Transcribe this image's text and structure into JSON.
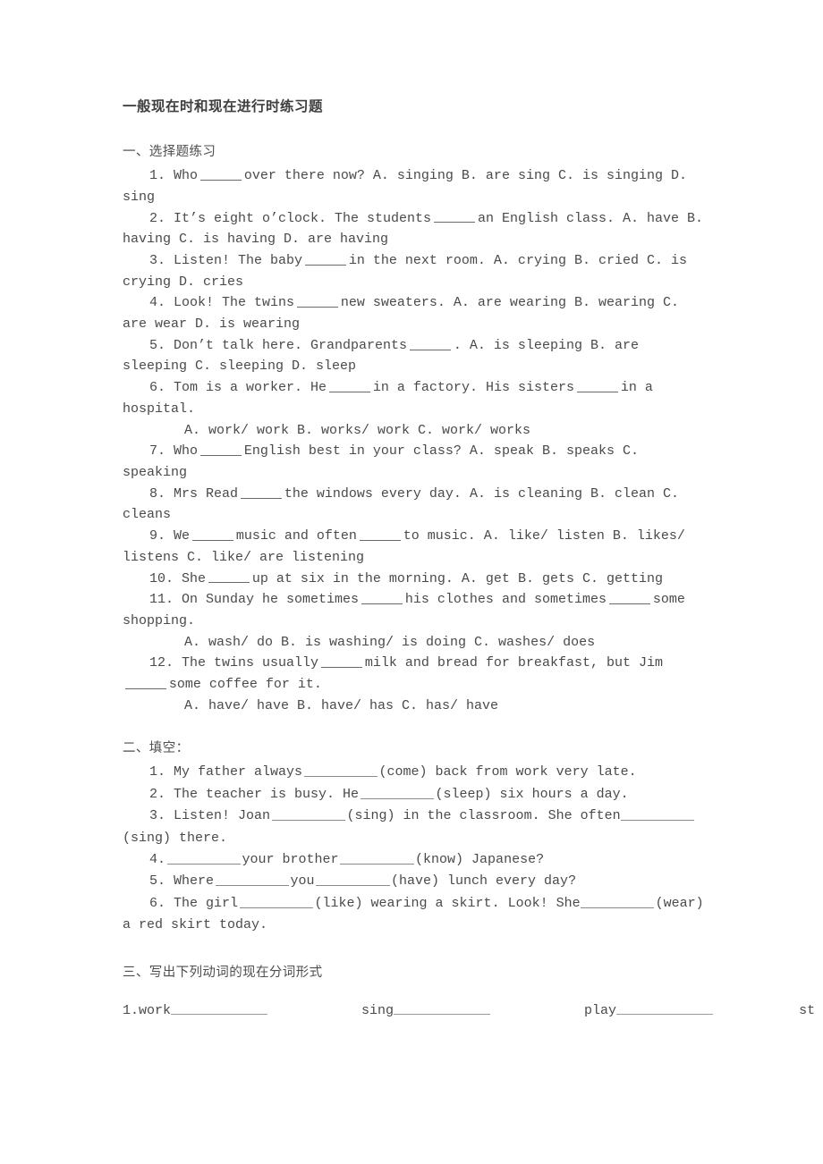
{
  "document": {
    "title": "一般现在时和现在进行时练习题"
  },
  "section_one": {
    "heading": "一、选择题练习",
    "questions": [
      {
        "parts": [
          "1. Who ",
          " over there now?    A. singing     B. are sing     C. is singing     D. sing"
        ],
        "blanks": 1,
        "text_before": "1. Who",
        "text_after": "over there now?    A. singing     B. are sing     C. is singing     D. sing"
      },
      {
        "text_before": "2. It’s eight o’clock. The students",
        "text_after": "an English class.     A. have    B. having    C. is having D. are having"
      },
      {
        "text_before": "3. Listen! The baby",
        "text_after": "in the next room.    A. crying    B. cried    C. is crying     D. cries"
      },
      {
        "text_before": "4. Look! The twins",
        "text_after": "new sweaters.    A. are wearing    B. wearing    C. are wear    D. is wearing"
      },
      {
        "text_before": "5. Don’t talk here. Grandparents",
        "text_after": ". A. is sleeping    B. are sleeping    C. sleeping    D. sleep"
      },
      {
        "text_before": "6. Tom is a worker. He",
        "text_middle": "in a factory. His sisters",
        "text_after": "in a hospital."
      },
      {
        "options_line": "A. work/ work    B. works/ work    C. work/ works"
      },
      {
        "text_before": "7. Who",
        "text_after": "English best in your class?    A. speak    B. speaks    C. speaking"
      },
      {
        "text_before": "8. Mrs Read",
        "text_after": "the windows every day.    A. is cleaning    B. clean    C. cleans"
      },
      {
        "text_before": "9. We",
        "text_middle": "music and often",
        "text_after": "to music.    A. like/ listen    B. likes/ listens    C. like/ are listening"
      },
      {
        "text_before": "10. She",
        "text_after": "up at six in the morning.    A. get    B. gets    C. getting"
      },
      {
        "text_before": "11. On Sunday he sometimes",
        "text_middle": "his clothes and sometimes",
        "text_after": "some shopping."
      },
      {
        "options_line": "A. wash/ do    B. is washing/ is doing    C. washes/ does"
      },
      {
        "text_before": "12. The twins usually",
        "text_middle": "milk and bread for breakfast, but Jim",
        "text_after": "some coffee for it."
      },
      {
        "options_line": "A. have/ have    B. have/ has    C. has/ have"
      }
    ],
    "q1_before": "1. Who",
    "q1_after": "over there now?    A. singing     B. are sing     C. is singing     D. sing",
    "q2_before": "2. It’s eight o’clock. The students",
    "q2_after": "an English class.     A. have    B. having    C. is having D. are having",
    "q3_before": "3. Listen! The baby",
    "q3_after": "in the next room.    A. crying    B. cried    C. is crying     D. cries",
    "q4_before": "4. Look! The twins",
    "q4_after": "new sweaters.    A. are wearing    B. wearing    C. are wear    D. is wearing",
    "q5_before": "5. Don’t talk here. Grandparents",
    "q5_after": ". A. is sleeping    B. are sleeping    C. sleeping    D. sleep",
    "q6_before": "6. Tom is a worker. He",
    "q6_middle": "in a factory. His sisters",
    "q6_after": "in a hospital.",
    "q6_options": "A. work/ work    B. works/ work    C. work/ works",
    "q7_before": "7. Who",
    "q7_after": "English best in your class?    A. speak    B. speaks    C. speaking",
    "q8_before": "8. Mrs Read",
    "q8_after": "the windows every day.    A. is cleaning    B. clean    C. cleans",
    "q9_before": "9. We",
    "q9_middle": "music and often",
    "q9_after": "to music.    A. like/ listen    B. likes/ listens    C. like/ are listening",
    "q10_before": "10. She",
    "q10_after": "up at six in the morning.    A. get    B. gets    C. getting",
    "q11_before": "11. On Sunday he sometimes",
    "q11_middle": "his clothes and sometimes",
    "q11_after": "some shopping.",
    "q11_options": "A. wash/ do    B. is washing/ is doing    C. washes/ does",
    "q12_before": "12. The twins usually",
    "q12_middle": "milk and bread for breakfast, but Jim",
    "q12_after": "some coffee for it.",
    "q12_options": "A. have/ have    B. have/ has    C. has/ have"
  },
  "section_two": {
    "heading": "二、填空：",
    "f1_before": "1. My father always",
    "f1_after": "(come) back from work very late.",
    "f2_before": "2. The teacher is busy. He",
    "f2_after": "(sleep) six hours a day.",
    "f3_before": "3. Listen! Joan",
    "f3_middle": "(sing) in the classroom. She often",
    "f3_after": "(sing) there.",
    "f4_before": "4.",
    "f4_middle": "your brother",
    "f4_after": "(know) Japanese?",
    "f5_before": "5. Where",
    "f5_middle": "you",
    "f5_after": "(have) lunch every day?",
    "f6_before": "6. The girl",
    "f6_middle": "(like) wearing a skirt. Look! She",
    "f6_after": "(wear) a red skirt today."
  },
  "section_three": {
    "heading": "三、写出下列动词的现在分词形式",
    "row_number": "1.",
    "verbs": [
      "work",
      "sing",
      "play"
    ],
    "truncated_verb": "st"
  }
}
